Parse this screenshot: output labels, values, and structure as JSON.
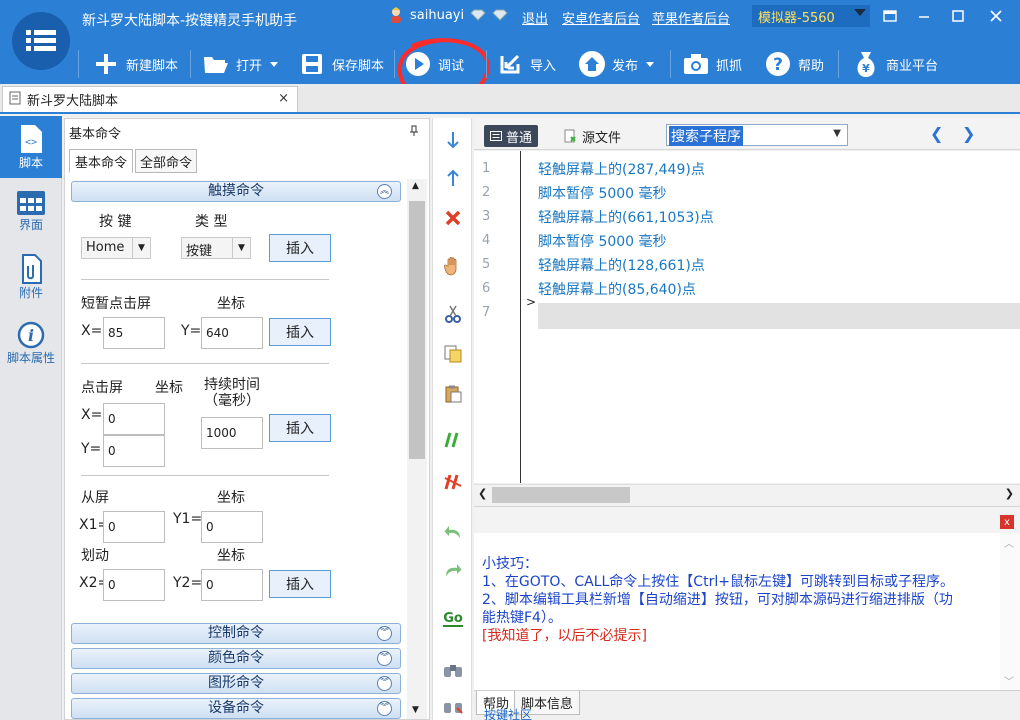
{
  "app": {
    "title": "新斗罗大陆脚本-按键精灵手机助手",
    "username": "saihuayi",
    "logout": "退出",
    "android_backend": "安卓作者后台",
    "apple_backend": "苹果作者后台",
    "emulator": "模拟器-5560"
  },
  "toolbar": {
    "new_script": "新建脚本",
    "open": "打开",
    "save_script": "保存脚本",
    "debug": "调试",
    "import": "导入",
    "publish": "发布",
    "capture": "抓抓",
    "help": "帮助",
    "market": "商业平台"
  },
  "doc_tab": {
    "label": "新斗罗大陆脚本",
    "close": "×"
  },
  "left_nav": [
    {
      "label": "脚本",
      "icon": "script-icon",
      "active": true
    },
    {
      "label": "界面",
      "icon": "ui-grid-icon",
      "active": false
    },
    {
      "label": "附件",
      "icon": "attachment-icon",
      "active": false
    },
    {
      "label": "脚本属性",
      "icon": "info-icon",
      "active": false
    }
  ],
  "cmd_panel": {
    "title": "基本命令",
    "tabs": [
      "基本命令",
      "全部命令"
    ],
    "touch_section": "触摸命令",
    "key_label": "按 键",
    "type_label": "类 型",
    "key_value": "Home",
    "type_value": "按键",
    "insert": "插入",
    "tap_label": "短暂点击屏",
    "coord_label": "坐标",
    "x_label": "X=",
    "y_label": "Y=",
    "tap_x": "85",
    "tap_y": "640",
    "press_label": "点击屏",
    "duration_label": "持续时间\n（毫秒）",
    "press_x": "0",
    "press_y": "0",
    "press_duration": "1000",
    "swipe_from_label": "从屏",
    "swipe_label": "划动",
    "x1_label": "X1=",
    "y1_label": "Y1=",
    "x2_label": "X2=",
    "y2_label": "Y2=",
    "x1": "0",
    "y1": "0",
    "x2": "0",
    "y2": "0",
    "sections": [
      "控制命令",
      "颜色命令",
      "图形命令",
      "设备命令"
    ]
  },
  "editor": {
    "mode_normal": "普通",
    "mode_source": "源文件",
    "sub_search": "搜索子程序",
    "lines": [
      "轻触屏幕上的(287,449)点",
      "脚本暂停 5000 毫秒",
      "轻触屏幕上的(661,1053)点",
      "脚本暂停 5000 毫秒",
      "轻触屏幕上的(128,661)点",
      "轻触屏幕上的(85,640)点",
      ""
    ],
    "line_numbers": [
      "1",
      "2",
      "3",
      "4",
      "5",
      "6",
      "7"
    ]
  },
  "help": {
    "tip_title": "小技巧：",
    "tip1": "1、在GOTO、CALL命令上按住【Ctrl+鼠标左键】可跳转到目标或子程序。",
    "tip2a": "2、脚本编辑工具栏新增【自动缩进】按钮，可对脚本源码进行缩进排版（功",
    "tip2b": "能热键F4）。",
    "dismiss": "[我知道了，以后不必提示]",
    "close": "x"
  },
  "bottom_tabs": [
    "帮助",
    "脚本信息"
  ],
  "community": "按键社区",
  "colors": {
    "primary": "#2b7fd4",
    "code": "#1a78c2",
    "tip": "#1b44c8",
    "dismiss": "#d62a1f",
    "emulator": "#ffe05a"
  }
}
